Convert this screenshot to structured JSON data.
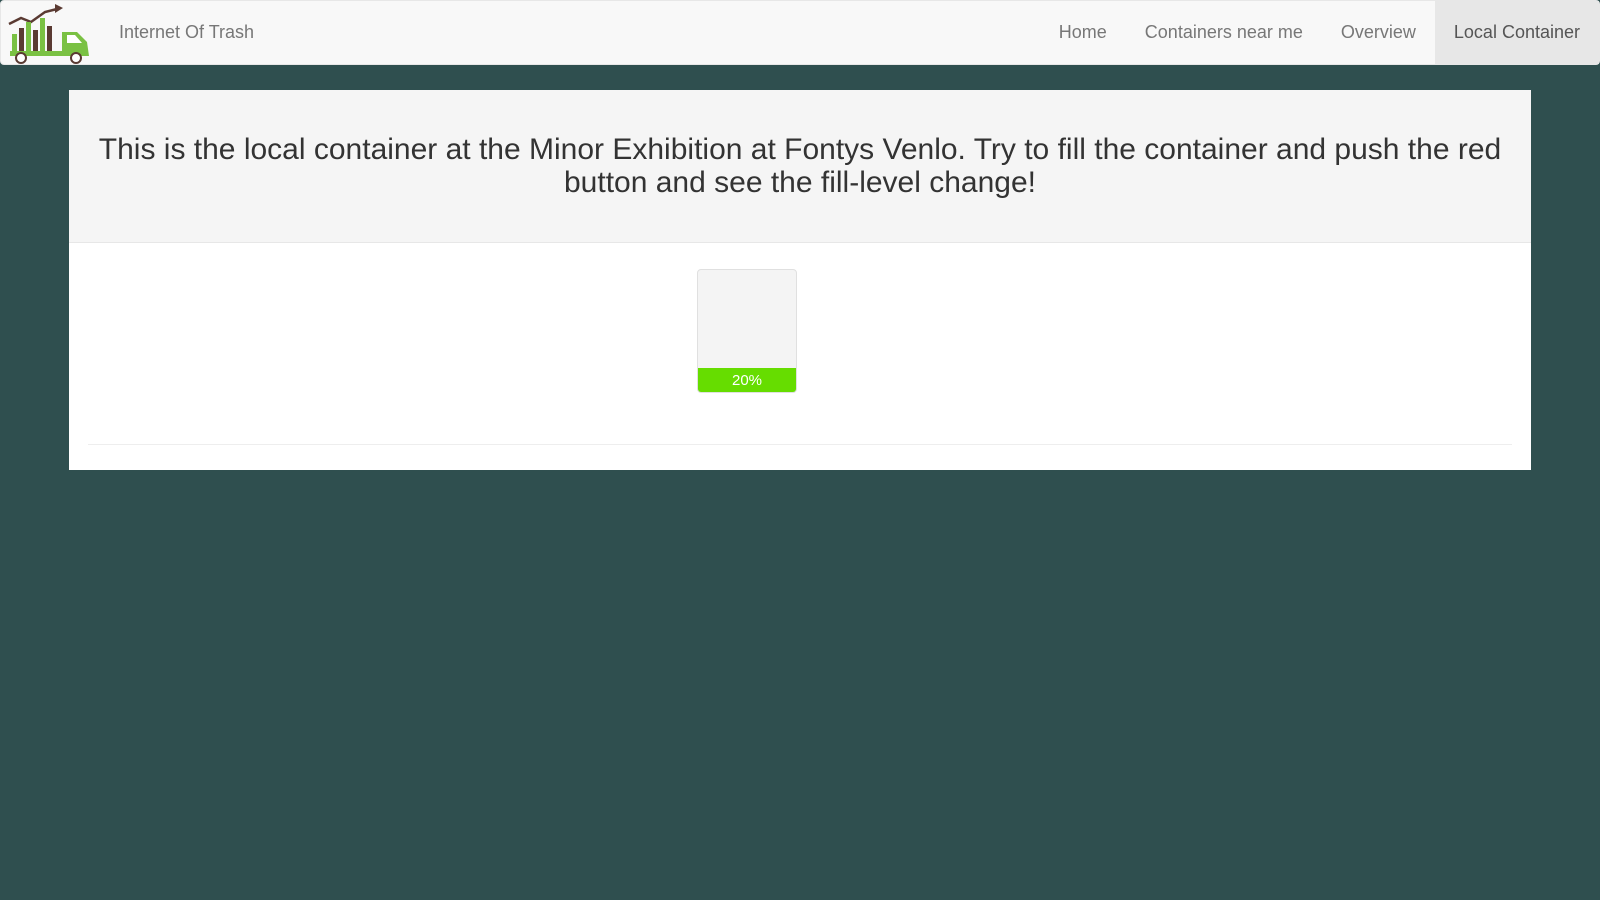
{
  "navbar": {
    "brand": "Internet Of Trash",
    "items": [
      {
        "label": "Home"
      },
      {
        "label": "Containers near me"
      },
      {
        "label": "Overview"
      },
      {
        "label": "Local Container",
        "active": true
      }
    ]
  },
  "jumbotron": {
    "text": "This is the local container at the Minor Exhibition at Fontys Venlo. Try to fill the container and push the red button and see the fill-level change!"
  },
  "container": {
    "fill_label": "20%",
    "fill_level": 0.2,
    "fill_color": "#66dd00"
  },
  "colors": {
    "page_background": "#2f4f4f",
    "logo_green": "#7ac143",
    "logo_dark": "#5a3a32"
  }
}
